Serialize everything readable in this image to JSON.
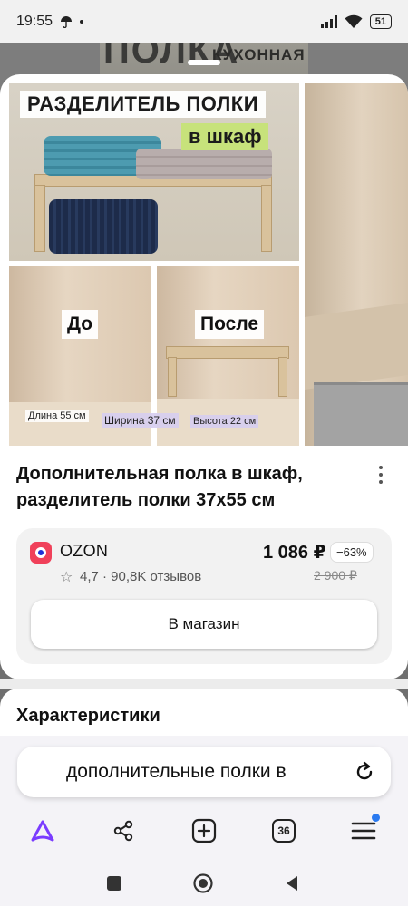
{
  "status_bar": {
    "time": "19:55",
    "battery": "51",
    "icons": [
      "umbrella-icon",
      "dot-icon",
      "signal-icon",
      "wifi-icon",
      "battery-icon"
    ]
  },
  "background_page": {
    "image_text_large": "ПОЛКА",
    "image_text_small": "КУХОННАЯ"
  },
  "gallery": {
    "main_image": {
      "banner_top": "РАЗДЕЛИТЕЛЬ ПОЛКИ",
      "banner_sub": "в шкаф",
      "label_before": "До",
      "label_after": "После",
      "dim_length": "Длина 55 см",
      "dim_width": "Ширина 37 см",
      "dim_height": "Высота 22 см"
    }
  },
  "product": {
    "title": "Дополнительная полка в шкаф, разделитель полки 37х55 см"
  },
  "offer": {
    "store": "OZON",
    "rating_text": "4,7 · 90,8K отзывов",
    "price": "1 086 ₽",
    "discount": "−63%",
    "old_price": "2 900 ₽",
    "button_label": "В магазин"
  },
  "characteristics": {
    "title": "Характеристики"
  },
  "search_bar": {
    "query": "дополнительные полки в"
  },
  "toolbar": {
    "tabs_count": "36"
  },
  "colors": {
    "accent_alice": "#7a3cff",
    "ozon_brand": "#f0415a",
    "badge_blue": "#2a7af0"
  }
}
